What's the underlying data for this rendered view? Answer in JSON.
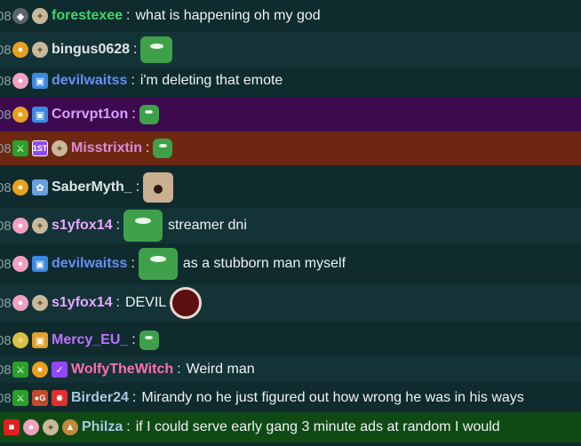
{
  "rows": [
    {
      "ts": "08",
      "user": "forestexee",
      "color": "#3fd66a",
      "msg": "what is happening oh my god"
    },
    {
      "ts": "08",
      "user": "bingus0628",
      "color": "#dfe6e6",
      "msg": ""
    },
    {
      "ts": "08",
      "user": "devilwaitss",
      "color": "#6a8cf7",
      "msg": "i'm deleting that emote"
    },
    {
      "ts": "08",
      "user": "Corrvpt1on",
      "color": "#d9a0ff",
      "msg": ""
    },
    {
      "ts": "08",
      "user": "Misstrixtin",
      "color": "#d98ad9",
      "msg": "",
      "first_badge": "1ST"
    },
    {
      "ts": "08",
      "user": "SaberMyth_",
      "color": "#dfe6e6",
      "msg": ""
    },
    {
      "ts": "08",
      "user": "s1yfox14",
      "color": "#e8a8ff",
      "msg": "streamer dni"
    },
    {
      "ts": "08",
      "user": "devilwaitss",
      "color": "#6a8cf7",
      "msg": "as a stubborn man myself"
    },
    {
      "ts": "08",
      "user": "s1yfox14",
      "color": "#e8a8ff",
      "msg": "DEVIL"
    },
    {
      "ts": "08",
      "user": "Mercy_EU_",
      "color": "#c070ff",
      "msg": ""
    },
    {
      "ts": "08",
      "user": "WolfyTheWitch",
      "color": "#ff70b0",
      "msg": "Weird man"
    },
    {
      "ts": "08",
      "user": "Birder24",
      "color": "#a8c8e0",
      "msg": "Mirandy no he just figured out how wrong he was in his ways"
    },
    {
      "ts": "",
      "user": "Philza",
      "color": "#a8c8e0",
      "msg": "if I could serve early gang 3 minute ads at random I would"
    }
  ],
  "colors": {
    "background": "#0f2b2e",
    "highlight_purple": "#3d0a4f",
    "highlight_brown": "#6e2812",
    "highlight_green": "#0f4a15"
  },
  "icons": [
    "gem-badge-icon",
    "star-badge-icon",
    "apple-badge-icon",
    "gift-badge-icon",
    "mod-sword-icon",
    "first-badge-icon",
    "tulip-badge-icon",
    "verified-badge-icon",
    "recording-badge-icon",
    "frog-emote-icon",
    "dog-emote-icon",
    "devil-emote-icon"
  ]
}
